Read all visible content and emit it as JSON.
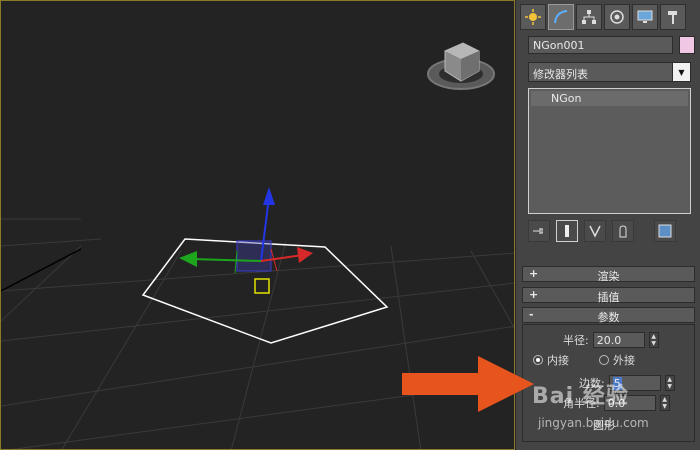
{
  "viewport": {
    "name": "perspective-viewport"
  },
  "command_panel": {
    "tabs": [
      "create",
      "modify",
      "hierarchy",
      "motion",
      "display",
      "utilities"
    ],
    "object_name": "NGon001",
    "object_color": "#f0c8e6",
    "modifier_list": "修改器列表",
    "stack_items": [
      "NGon"
    ],
    "rollouts": {
      "rendering": "渲染",
      "interpolation": "插值",
      "parameters": "参数"
    },
    "params": {
      "radius_label": "半径:",
      "radius_value": "20.0",
      "inscribed_label": "内接",
      "circumscribed_label": "外接",
      "sides_label": "边数:",
      "sides_value": "5",
      "corner_label": "角半径:",
      "corner_value": "0.0",
      "circular_label": "圆形"
    }
  },
  "overlay": {
    "arrow_color": "#e8541e",
    "watermark_text": "Bai 经验",
    "watermark_url": "jingyan.baidu.com"
  }
}
